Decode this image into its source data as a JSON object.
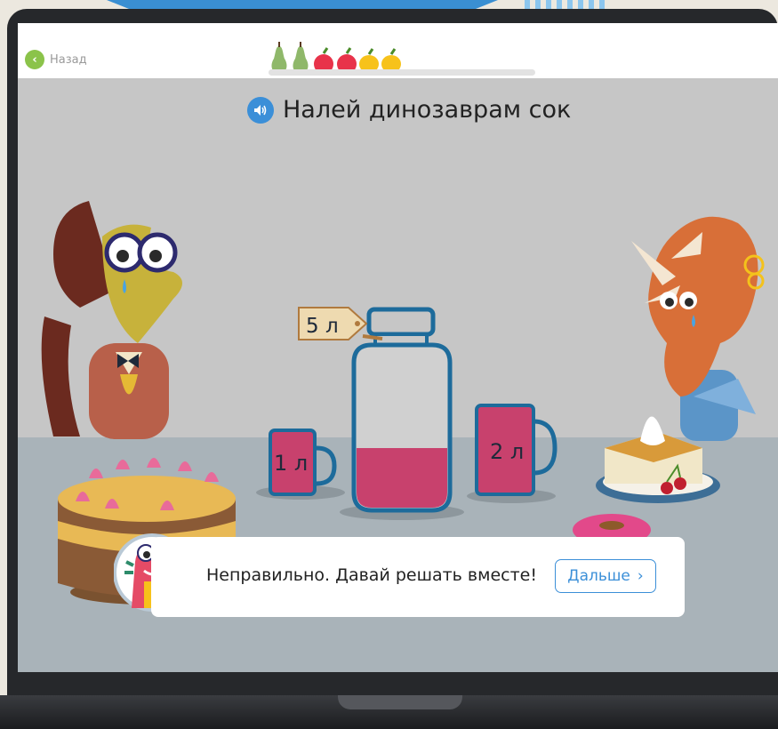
{
  "topbar": {
    "back_label": "Назад",
    "fruits": [
      "pear-icon",
      "pear-icon",
      "apple-icon",
      "apple-icon",
      "lemon-icon",
      "lemon-icon"
    ]
  },
  "task": {
    "title": "Налей динозаврам сок"
  },
  "scene": {
    "jar_label": "5 л",
    "small_cup_label": "1 л",
    "large_cup_label": "2 л",
    "juice_color": "#c8416d",
    "vessel_color": "#1d6b9b"
  },
  "feedback": {
    "message": "Неправильно. Давай решать вместе!",
    "next_label": "Дальше"
  },
  "colors": {
    "accent": "#3b8fd8",
    "back_button": "#8bc34a",
    "screen_bg": "#c6c6c6",
    "table": "#a9b3b9"
  }
}
